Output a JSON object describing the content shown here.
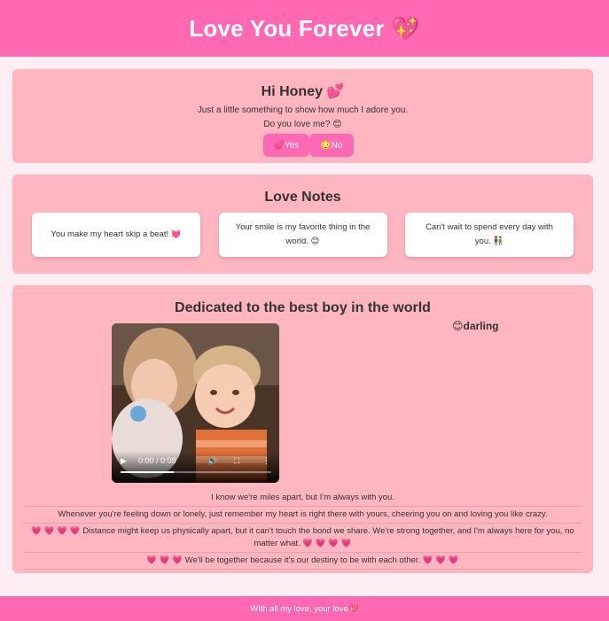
{
  "header": {
    "title": "Love You Forever 💖"
  },
  "greeting": {
    "title": "Hi Honey 💕",
    "subtitle": "Just a little something to show how much I adore you.",
    "question": "Do you love me? 😊",
    "yes_label": "💕Yes",
    "no_label": "😳No"
  },
  "notes": {
    "title": "Love Notes",
    "items": [
      "You make my heart skip a beat! 💓",
      "Your smile is my favorite thing in the world. 😊",
      "Can't wait to spend every day with you. 👫"
    ]
  },
  "dedication": {
    "title": "Dedicated to the best boy in the world",
    "label": "😊darling",
    "video": {
      "time": "0:00 / 0:08",
      "progress": 0.35
    },
    "lines": [
      "I know we're miles apart, but I'm always with you.",
      "Whenever you're feeling down or lonely, just remember my heart is right there with yours, cheering you on and loving you like crazy.",
      "💗 💗 💗 💗 Distance might keep us physically apart, but it can't touch the bond we share. We're strong together, and I'm always here for you, no matter what. 💗 💗 💗 💗",
      "💗 💗 💗  We'll be together because it's our destiny to be with each other. 💗 💗 💗"
    ]
  },
  "footer": {
    "text": "With all my love, your love💖"
  }
}
